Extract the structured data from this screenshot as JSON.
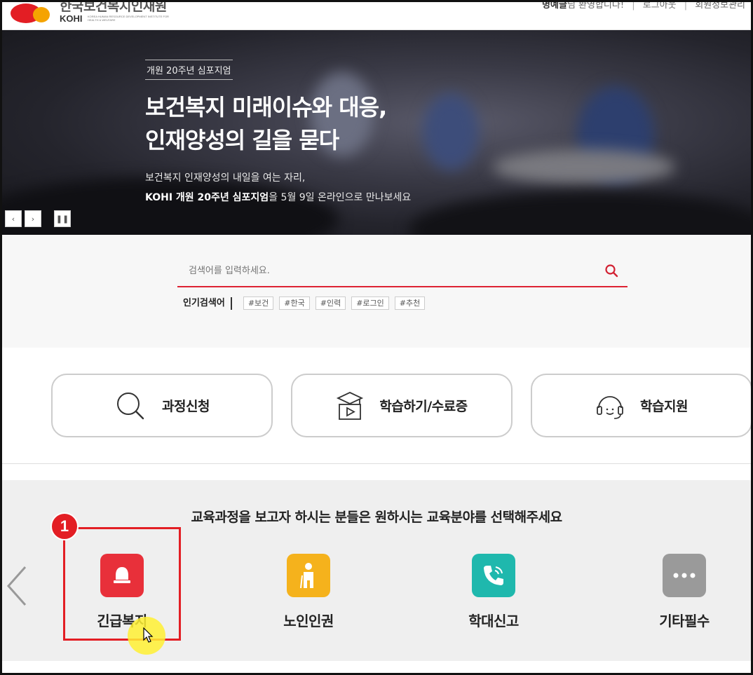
{
  "header": {
    "logo_ko": "한국보건복지인재원",
    "logo_en": "KOHI",
    "logo_sub": "KOREA HUMAN RESOURCE DEVELOPMENT INSTITUTE FOR HEALTH & WELFARE",
    "user_name": "명예글",
    "welcome_suffix": "님 환영합니다!",
    "logout": "로그아웃",
    "member_info": "회원정보관리",
    "logo_colors": [
      "#e31e24",
      "#f5a300"
    ]
  },
  "hero": {
    "tag": "개원 20주년 심포지엄",
    "title_line1": "보건복지 미래이슈와 대응,",
    "title_line2": "인재양성의 길을 묻다",
    "desc_line1": "보건복지 인재양성의 내일을 여는 자리,",
    "desc_bold": "KOHI 개원 20주년 심포지엄",
    "desc_rest": "을 5월 9일 온라인으로 만나보세요",
    "controls": [
      "‹",
      "›",
      "❚❚"
    ]
  },
  "search": {
    "placeholder": "검색어를 입력하세요.",
    "popular_label": "인기검색어",
    "tags": [
      "#보건",
      "#한국",
      "#인력",
      "#로그인",
      "#추천"
    ],
    "accent": "#d22233"
  },
  "quick_links": [
    {
      "label": "과정신청",
      "icon": "magnifier-icon"
    },
    {
      "label": "학습하기/수료증",
      "icon": "graduation-video-icon"
    },
    {
      "label": "학습지원",
      "icon": "headset-icon"
    }
  ],
  "categories": {
    "title": "교육과정을 보고자 하시는 분들은 원하시는 교육분야를 선택해주세요",
    "items": [
      {
        "label": "긴급복지",
        "icon": "bell-icon",
        "color": "#e8303a"
      },
      {
        "label": "노인인권",
        "icon": "elderly-person-icon",
        "color": "#f5b21c"
      },
      {
        "label": "학대신고",
        "icon": "phone-icon",
        "color": "#1fb8ad"
      },
      {
        "label": "기타필수",
        "icon": "more-dots-icon",
        "color": "#9a9a9a"
      }
    ]
  },
  "annotation": {
    "step": "1",
    "color": "#e31e24"
  }
}
